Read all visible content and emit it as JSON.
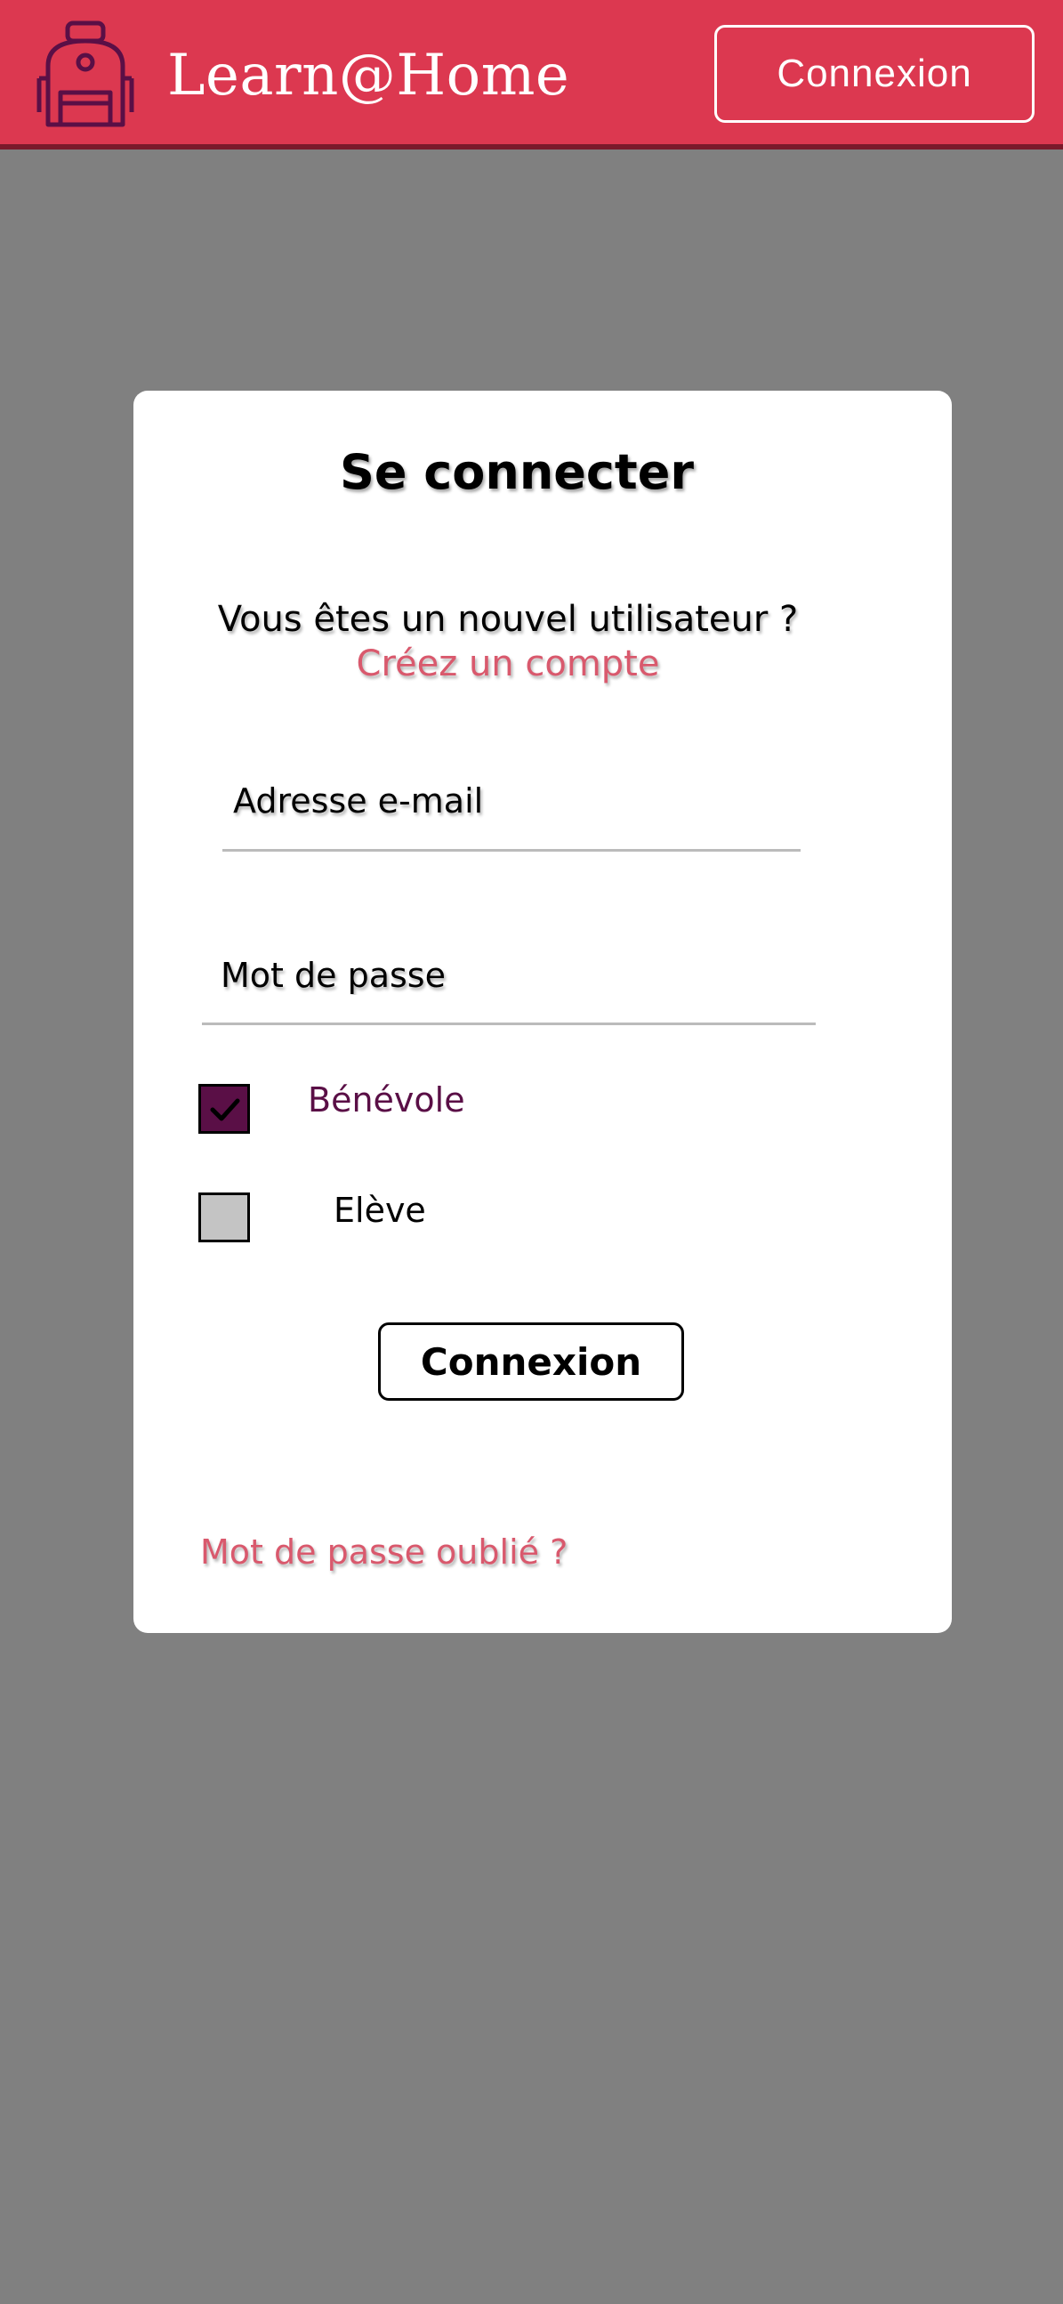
{
  "header": {
    "brand": "Learn@Home",
    "login_button": "Connexion",
    "logo_icon": "backpack-icon",
    "background_color": "#dc3850"
  },
  "login_form": {
    "title": "Se connecter",
    "new_user_text": "Vous êtes un nouvel utilisateur ?",
    "create_account_link": "Créez un compte",
    "email_placeholder": "Adresse e-mail",
    "email_value": "",
    "password_placeholder": "Mot de passe",
    "password_value": "",
    "role_options": [
      {
        "label": "Bénévole",
        "checked": true
      },
      {
        "label": "Elève",
        "checked": false
      }
    ],
    "submit_button": "Connexion",
    "forgot_password_link": "Mot de passe oublié ?"
  },
  "colors": {
    "accent": "#dc3850",
    "link": "#d9596d",
    "checkbox_checked": "#5a0f46",
    "checkbox_unchecked": "#c4c4c4",
    "page_background": "#808080"
  }
}
